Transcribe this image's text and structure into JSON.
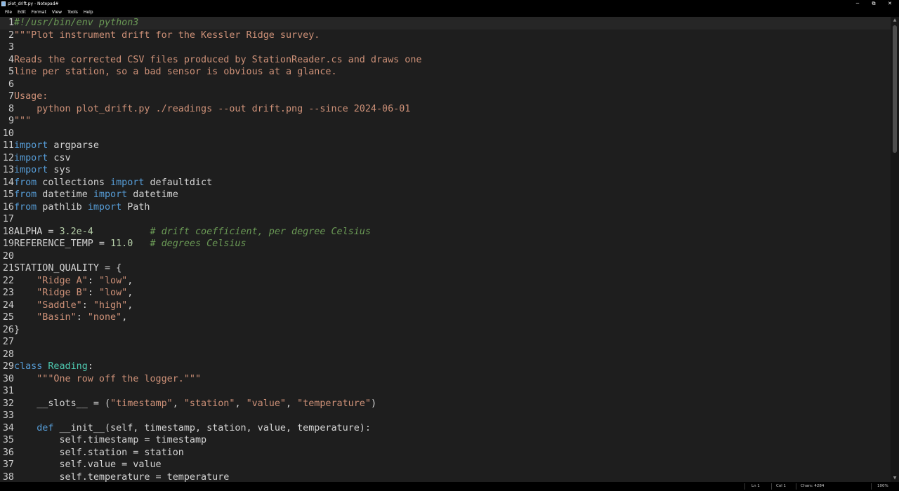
{
  "window": {
    "title": "plot_drift.py - Notepad#",
    "controls": {
      "minimize": "─",
      "restore": "⧉",
      "close": "✕"
    }
  },
  "menu": [
    "File",
    "Edit",
    "Format",
    "View",
    "Tools",
    "Help"
  ],
  "editor": {
    "current_line": 1,
    "lines": [
      [
        [
          "cmt",
          "#!/usr/bin/env python3"
        ]
      ],
      [
        [
          "str",
          "\"\"\"Plot instrument drift for the Kessler Ridge survey."
        ]
      ],
      [],
      [
        [
          "str",
          "Reads the corrected CSV files produced by StationReader.cs and draws one"
        ]
      ],
      [
        [
          "str",
          "line per station, so a bad sensor is obvious at a glance."
        ]
      ],
      [],
      [
        [
          "str",
          "Usage:"
        ]
      ],
      [
        [
          "str",
          "    python plot_drift.py ./readings --out drift.png --since 2024-06-01"
        ]
      ],
      [
        [
          "str",
          "\"\"\""
        ]
      ],
      [],
      [
        [
          "kw",
          "import"
        ],
        [
          "plain",
          " argparse"
        ]
      ],
      [
        [
          "kw",
          "import"
        ],
        [
          "plain",
          " csv"
        ]
      ],
      [
        [
          "kw",
          "import"
        ],
        [
          "plain",
          " sys"
        ]
      ],
      [
        [
          "kw",
          "from"
        ],
        [
          "plain",
          " collections "
        ],
        [
          "kw",
          "import"
        ],
        [
          "plain",
          " defaultdict"
        ]
      ],
      [
        [
          "kw",
          "from"
        ],
        [
          "plain",
          " datetime "
        ],
        [
          "kw",
          "import"
        ],
        [
          "plain",
          " datetime"
        ]
      ],
      [
        [
          "kw",
          "from"
        ],
        [
          "plain",
          " pathlib "
        ],
        [
          "kw",
          "import"
        ],
        [
          "plain",
          " Path"
        ]
      ],
      [],
      [
        [
          "plain",
          "ALPHA = "
        ],
        [
          "num",
          "3.2e-4"
        ],
        [
          "plain",
          "          "
        ],
        [
          "cmt",
          "# drift coefficient, per degree Celsius"
        ]
      ],
      [
        [
          "plain",
          "REFERENCE_TEMP = "
        ],
        [
          "num",
          "11.0"
        ],
        [
          "plain",
          "   "
        ],
        [
          "cmt",
          "# degrees Celsius"
        ]
      ],
      [],
      [
        [
          "plain",
          "STATION_QUALITY = {"
        ]
      ],
      [
        [
          "plain",
          "    "
        ],
        [
          "str",
          "\"Ridge A\""
        ],
        [
          "plain",
          ": "
        ],
        [
          "str",
          "\"low\""
        ],
        [
          "plain",
          ","
        ]
      ],
      [
        [
          "plain",
          "    "
        ],
        [
          "str",
          "\"Ridge B\""
        ],
        [
          "plain",
          ": "
        ],
        [
          "str",
          "\"low\""
        ],
        [
          "plain",
          ","
        ]
      ],
      [
        [
          "plain",
          "    "
        ],
        [
          "str",
          "\"Saddle\""
        ],
        [
          "plain",
          ": "
        ],
        [
          "str",
          "\"high\""
        ],
        [
          "plain",
          ","
        ]
      ],
      [
        [
          "plain",
          "    "
        ],
        [
          "str",
          "\"Basin\""
        ],
        [
          "plain",
          ": "
        ],
        [
          "str",
          "\"none\""
        ],
        [
          "plain",
          ","
        ]
      ],
      [
        [
          "plain",
          "}"
        ]
      ],
      [],
      [],
      [
        [
          "kw",
          "class"
        ],
        [
          "plain",
          " "
        ],
        [
          "cls",
          "Reading"
        ],
        [
          "plain",
          ":"
        ]
      ],
      [
        [
          "plain",
          "    "
        ],
        [
          "str",
          "\"\"\"One row off the logger.\"\"\""
        ]
      ],
      [],
      [
        [
          "plain",
          "    __slots__ = ("
        ],
        [
          "str",
          "\"timestamp\""
        ],
        [
          "plain",
          ", "
        ],
        [
          "str",
          "\"station\""
        ],
        [
          "plain",
          ", "
        ],
        [
          "str",
          "\"value\""
        ],
        [
          "plain",
          ", "
        ],
        [
          "str",
          "\"temperature\""
        ],
        [
          "plain",
          ")"
        ]
      ],
      [],
      [
        [
          "plain",
          "    "
        ],
        [
          "kw",
          "def"
        ],
        [
          "plain",
          " __init__(self, timestamp, station, value, temperature):"
        ]
      ],
      [
        [
          "plain",
          "        self.timestamp = timestamp"
        ]
      ],
      [
        [
          "plain",
          "        self.station = station"
        ]
      ],
      [
        [
          "plain",
          "        self.value = value"
        ]
      ],
      [
        [
          "plain",
          "        self.temperature = temperature"
        ]
      ]
    ]
  },
  "status": {
    "ln": "Ln 1",
    "col": "Col 1",
    "chars": "Chars: 4284",
    "zoom": "100%"
  },
  "colors": {
    "keyword": "#569cd6",
    "string": "#ce9178",
    "comment": "#6a9955",
    "number": "#b5cea8",
    "class": "#4ec9b0",
    "plain": "#d4d4d4"
  }
}
